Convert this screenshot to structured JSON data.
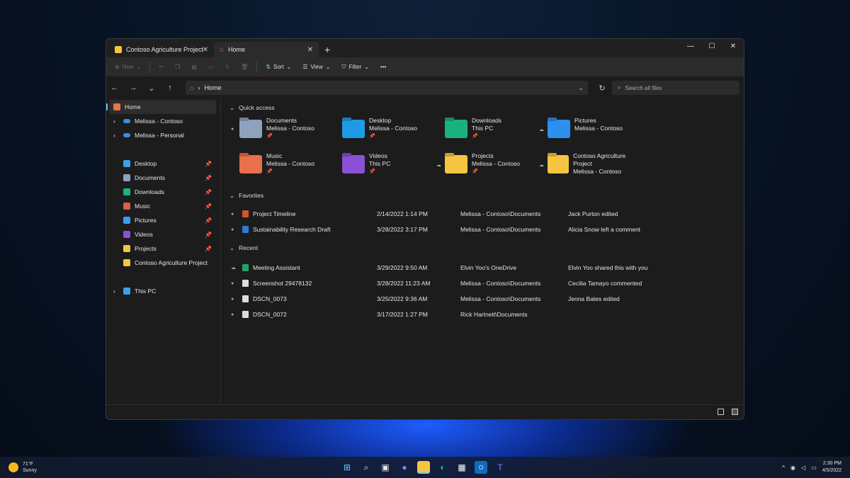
{
  "tabs": [
    {
      "label": "Contoso Agriculture Project",
      "icon": "folder-icon",
      "close": "✕"
    },
    {
      "label": "Home",
      "icon": "home-icon",
      "close": "✕"
    }
  ],
  "new_tab": "+",
  "window_controls": [
    "—",
    "☐",
    "✕"
  ],
  "toolbar": {
    "new": "New",
    "sort": "Sort",
    "view": "View",
    "filter": "Filter",
    "more": "•••"
  },
  "address": {
    "path": "Home",
    "search_placeholder": "Search all files"
  },
  "sidebar": {
    "top": [
      {
        "label": "Home",
        "icon": "home-icon",
        "color": "#e8734a"
      },
      {
        "label": "Melissa - Contoso",
        "icon": "onedrive-icon",
        "color": "#3a8ee6"
      },
      {
        "label": "Melissa - Personal",
        "icon": "onedrive-icon",
        "color": "#3a8ee6"
      }
    ],
    "pinned": [
      {
        "label": "Desktop",
        "color": "#3aa0e8",
        "pin": true
      },
      {
        "label": "Documents",
        "color": "#8da2bd",
        "pin": true
      },
      {
        "label": "Downloads",
        "color": "#1bb17f",
        "pin": true
      },
      {
        "label": "Music",
        "color": "#e05a4a",
        "pin": true
      },
      {
        "label": "Pictures",
        "color": "#3a9cf0",
        "pin": true
      },
      {
        "label": "Videos",
        "color": "#8b4fd8",
        "pin": true
      },
      {
        "label": "Projects",
        "color": "#f5c542",
        "pin": true
      },
      {
        "label": "Contoso Agriculture Project",
        "color": "#f5c542",
        "pin": false
      }
    ],
    "this_pc": {
      "label": "This PC",
      "color": "#3aa0e8"
    }
  },
  "quick_access": {
    "title": "Quick access",
    "items": [
      {
        "name": "Documents",
        "location": "Melissa - Contoso",
        "status": "synced",
        "color": "#8da2bd"
      },
      {
        "name": "Desktop",
        "location": "Melissa - Contoso",
        "status": "",
        "color": "#1e9be6"
      },
      {
        "name": "Downloads",
        "location": "This PC",
        "status": "",
        "color": "#1bb17f"
      },
      {
        "name": "Pictures",
        "location": "Melissa - Contoso",
        "status": "cloud",
        "color": "#2d8ff0"
      },
      {
        "name": "Music",
        "location": "Melissa - Contoso",
        "status": "",
        "color": "#e8704a"
      },
      {
        "name": "Videos",
        "location": "This PC",
        "status": "",
        "color": "#8b4fd8"
      },
      {
        "name": "Projects",
        "location": "Melissa - Contoso",
        "status": "cloud",
        "color": "#f5c542"
      },
      {
        "name": "Contoso Agriculture Project",
        "location": "Melissa - Contoso",
        "status": "cloud",
        "color": "#f5c542"
      }
    ]
  },
  "favorites": {
    "title": "Favorites",
    "rows": [
      {
        "name": "Project Timeline",
        "date": "2/14/2022 1:14 PM",
        "location": "Melissa - Contoso\\Documents",
        "activity": "Jack Purton edited",
        "type": "powerpoint",
        "status": "synced"
      },
      {
        "name": "Sustainability Research Draft",
        "date": "3/28/2022 3:17 PM",
        "location": "Melissa - Contoso\\Documents",
        "activity": "Alicia Snow left a comment",
        "type": "word",
        "status": "synced"
      }
    ]
  },
  "recent": {
    "title": "Recent",
    "rows": [
      {
        "name": "Meeting Assistant",
        "date": "3/29/2022 9:50 AM",
        "location": "Elvin Yoo's OneDrive",
        "activity": "Elvin Yoo shared this with you",
        "type": "excel",
        "status": "cloud"
      },
      {
        "name": "Screenshot 29478132",
        "date": "3/28/2022 11:23 AM",
        "location": "Melissa - Contoso\\Documents",
        "activity": "Cecilia Tamayo commented",
        "type": "image",
        "status": "synced"
      },
      {
        "name": "DSCN_0073",
        "date": "3/25/2022 9:36 AM",
        "location": "Melissa - Contoso\\Documents",
        "activity": "Jenna Bates edited",
        "type": "image",
        "status": "synced"
      },
      {
        "name": "DSCN_0072",
        "date": "3/17/2022 1:27 PM",
        "location": "Rick Hartnett\\Documents",
        "activity": "",
        "type": "image",
        "status": "synced"
      }
    ]
  },
  "taskbar": {
    "weather_temp": "71°F",
    "weather_desc": "Sunny",
    "time": "2:30 PM",
    "date": "4/5/2022"
  }
}
